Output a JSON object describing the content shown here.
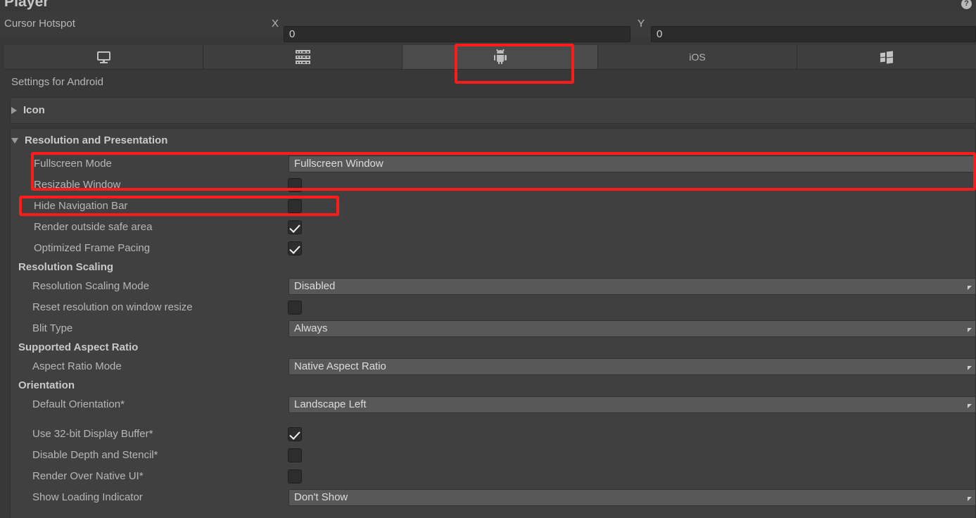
{
  "window": {
    "title": "Player",
    "help_icon": "help-icon"
  },
  "cursor_hotspot": {
    "label": "Cursor Hotspot",
    "x_label": "X",
    "x_value": "0",
    "y_label": "Y",
    "y_value": "0"
  },
  "platform_tabs": [
    {
      "id": "standalone",
      "icon": "monitor-icon",
      "label": "",
      "selected": false
    },
    {
      "id": "server",
      "icon": "server-icon",
      "label": "",
      "selected": false
    },
    {
      "id": "android",
      "icon": "android-icon",
      "label": "",
      "selected": true
    },
    {
      "id": "ios",
      "icon": "",
      "label": "iOS",
      "selected": false
    },
    {
      "id": "windows",
      "icon": "windows-icon",
      "label": "",
      "selected": false
    }
  ],
  "settings_header": "Settings for Android",
  "sections": [
    {
      "id": "icon",
      "label": "Icon",
      "expanded": false
    },
    {
      "id": "resolution",
      "label": "Resolution and Presentation",
      "expanded": true
    }
  ],
  "rows": [
    {
      "id": "fullscreen-mode",
      "label": "Fullscreen Mode",
      "type": "dropdown",
      "value": "Fullscreen Window",
      "indent": 1,
      "arrow": false
    },
    {
      "id": "resizable-window",
      "label": "Resizable Window",
      "type": "checkbox",
      "checked": false,
      "indent": 1
    },
    {
      "id": "hide-navigation-bar",
      "label": "Hide Navigation Bar",
      "type": "checkbox",
      "checked": false,
      "indent": 1
    },
    {
      "id": "render-outside-safe-area",
      "label": "Render outside safe area",
      "type": "checkbox",
      "checked": true,
      "indent": 1
    },
    {
      "id": "optimized-frame-pacing",
      "label": "Optimized Frame Pacing",
      "type": "checkbox",
      "checked": true,
      "indent": 1
    },
    {
      "id": "resolution-scaling-group",
      "label": "Resolution Scaling",
      "type": "group"
    },
    {
      "id": "resolution-scaling-mode",
      "label": "Resolution Scaling Mode",
      "type": "dropdown",
      "value": "Disabled",
      "indent": 1,
      "arrow": true
    },
    {
      "id": "reset-resolution",
      "label": "Reset resolution on window resize",
      "type": "checkbox",
      "checked": false,
      "indent": 1
    },
    {
      "id": "blit-type",
      "label": "Blit Type",
      "type": "dropdown",
      "value": "Always",
      "indent": 1,
      "arrow": true
    },
    {
      "id": "supported-aspect-ratio-group",
      "label": "Supported Aspect Ratio",
      "type": "group"
    },
    {
      "id": "aspect-ratio-mode",
      "label": "Aspect Ratio Mode",
      "type": "dropdown",
      "value": "Native Aspect Ratio",
      "indent": 1,
      "arrow": true
    },
    {
      "id": "orientation-group",
      "label": "Orientation",
      "type": "group"
    },
    {
      "id": "default-orientation",
      "label": "Default Orientation*",
      "type": "dropdown",
      "value": "Landscape Left",
      "indent": 1,
      "arrow": true
    },
    {
      "id": "use-32bit-display-buffer",
      "label": "Use 32-bit Display Buffer*",
      "type": "checkbox",
      "checked": true,
      "indent": 1
    },
    {
      "id": "disable-depth-stencil",
      "label": "Disable Depth and Stencil*",
      "type": "checkbox",
      "checked": false,
      "indent": 1
    },
    {
      "id": "render-over-native-ui",
      "label": "Render Over Native UI*",
      "type": "checkbox",
      "checked": false,
      "indent": 1
    },
    {
      "id": "show-loading-indicator",
      "label": "Show Loading Indicator",
      "type": "dropdown",
      "value": "Don't Show",
      "indent": 1,
      "arrow": true
    }
  ],
  "annotations": [
    {
      "id": "android-tab-highlight",
      "target": "android-tab"
    },
    {
      "id": "fullscreen-rows-highlight",
      "target": "fullscreen-mode + resizable-window"
    },
    {
      "id": "hide-nav-bar-highlight",
      "target": "hide-navigation-bar"
    }
  ],
  "colors": {
    "background": "#383838",
    "panel": "#404040",
    "tab_selected": "#4b4b4b",
    "tab_normal": "#3e3e3e",
    "dropdown": "#585858",
    "annotation_red": "#fd1b1b",
    "text": "#b6b6b6"
  }
}
